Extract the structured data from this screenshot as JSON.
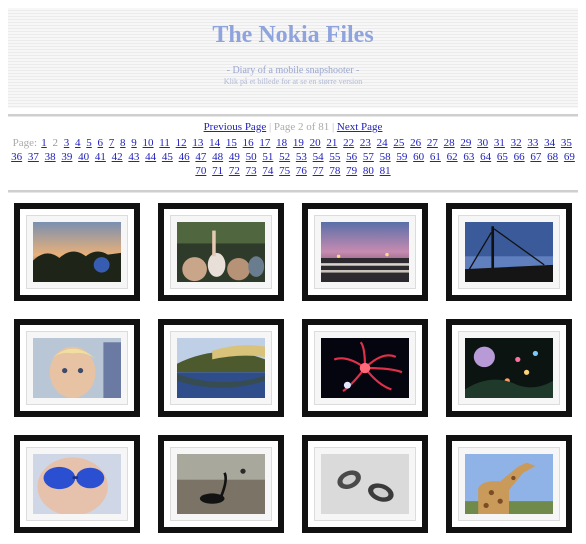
{
  "header": {
    "title": "The Nokia Files",
    "tagline": "- Diary of a mobile snapshooter -",
    "subtagline": "Klik på et billede for at se en større version"
  },
  "nav": {
    "previous": "Previous Page",
    "current": "Page 2 of 81",
    "next": "Next Page",
    "separator": "|",
    "page_label": "Page:",
    "current_page": "2",
    "pages": [
      "1",
      "2",
      "3",
      "4",
      "5",
      "6",
      "7",
      "8",
      "9",
      "10",
      "11",
      "12",
      "13",
      "14",
      "15",
      "16",
      "17",
      "18",
      "19",
      "20",
      "21",
      "22",
      "23",
      "24",
      "25",
      "26",
      "27",
      "28",
      "29",
      "30",
      "31",
      "32",
      "33",
      "34",
      "35",
      "36",
      "37",
      "38",
      "39",
      "40",
      "41",
      "42",
      "43",
      "44",
      "45",
      "46",
      "47",
      "48",
      "49",
      "50",
      "51",
      "52",
      "53",
      "54",
      "55",
      "56",
      "57",
      "58",
      "59",
      "60",
      "61",
      "62",
      "63",
      "64",
      "65",
      "66",
      "67",
      "68",
      "69",
      "70",
      "71",
      "72",
      "73",
      "74",
      "75",
      "76",
      "77",
      "78",
      "79",
      "80",
      "81"
    ]
  },
  "gallery": {
    "thumbnails": [
      {
        "subject": "sunset-trees"
      },
      {
        "subject": "concert-crowd"
      },
      {
        "subject": "dusk-fence"
      },
      {
        "subject": "ship-rigging"
      },
      {
        "subject": "child-face"
      },
      {
        "subject": "lake-reflection"
      },
      {
        "subject": "red-firework"
      },
      {
        "subject": "night-lanterns"
      },
      {
        "subject": "sunglasses-face"
      },
      {
        "subject": "swan-pond"
      },
      {
        "subject": "shoes-in-snow"
      },
      {
        "subject": "giraffe"
      }
    ]
  },
  "colors": {
    "title": "#8fa3dd",
    "link": "#2222bb",
    "frame": "#111111"
  }
}
